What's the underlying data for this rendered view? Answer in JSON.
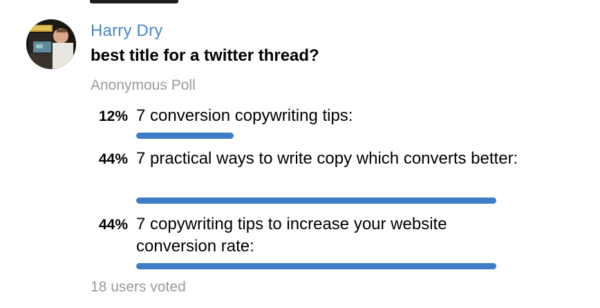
{
  "message": {
    "sender": "Harry Dry",
    "question": "best title for a twitter thread?",
    "poll_type": "Anonymous Poll",
    "votes_text": "18 users voted"
  },
  "poll": {
    "bar_color": "#3d7dc6",
    "options": [
      {
        "percent_label": "12%",
        "text": "7 conversion copywriting tips:",
        "fraction": 0.27
      },
      {
        "percent_label": "44%",
        "text": "7 practical ways to write copy which converts better:",
        "fraction": 1.0
      },
      {
        "percent_label": "44%",
        "text": "7 copywriting tips to increase your website conversion rate:",
        "fraction": 1.0
      }
    ]
  },
  "colors": {
    "sender_name": "#4a87c6",
    "muted_text": "#9a9a9a"
  },
  "icons": {
    "avatar": "user-photo-arcade-avatar"
  }
}
